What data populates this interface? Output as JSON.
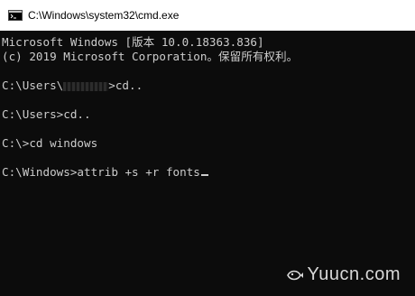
{
  "window": {
    "title": "C:\\Windows\\system32\\cmd.exe",
    "icon": "cmd-icon"
  },
  "console": {
    "header_line1": "Microsoft Windows [版本 10.0.18363.836]",
    "header_line2": "(c) 2019 Microsoft Corporation。保留所有权利。",
    "prompt1_prefix": "C:\\Users\\",
    "prompt1_suffix": ">cd..",
    "prompt2": "C:\\Users>cd..",
    "prompt3": "C:\\>cd windows",
    "prompt4": "C:\\Windows>attrib +s +r fonts"
  },
  "watermark": {
    "text": "Yuucn.com"
  },
  "colors": {
    "background": "#0c0c0c",
    "text": "#cccccc",
    "titlebar": "#ffffff"
  }
}
